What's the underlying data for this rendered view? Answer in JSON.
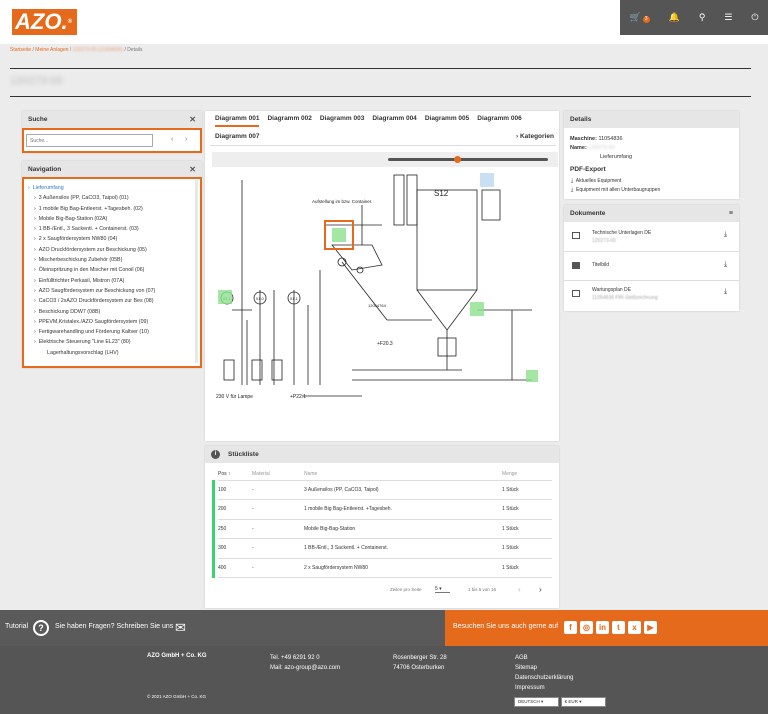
{
  "header": {
    "logo": "AZO.",
    "cart_count": "3"
  },
  "breadcrumb": {
    "home": "Startseite",
    "machines": "Meine Anlagen",
    "machine": "120273-00 (11054836)",
    "details": "Details"
  },
  "page_title": "120273-00",
  "search": {
    "title": "Suche",
    "placeholder": "Suche..."
  },
  "navigation": {
    "title": "Navigation",
    "root": "Lieferumfang",
    "items": [
      "3 Außensilos (PP, CaCO3, Taipol) (01)",
      "1 mobile Big Bag-Entleerst. +Tagesbeh. (02)",
      "Mobile Big-Bag-Station (02A)",
      "1 BB-/Entl., 3 Sackentl. + Containerst. (03)",
      "2 x Saugfördersystem NW80 (04)",
      "AZO Druckfördersystem zur Beschickung (05)",
      "Mischerbeschickung Zubehör (05B)",
      "Öleinspritzung in den Mischer mit Conoil (06)",
      "Einfülltrichter Perkasil, Mistron (07A)",
      "AZO Saugfördersystem zur Beschickung von (07)",
      "CaCO3 / 2xAZO Druckfördersystem zur Bes (08)",
      "Beschickung DDW7 (08B)",
      "PPEVM,Kristalex./AZO Saugfördersystem (09)",
      "Fertigwarehandling und Förderung Kaltver (10)",
      "Elektrische Steuerung \"Line EL23\" (80)",
      "Lagerhaltungsvorschlag (LHV)"
    ]
  },
  "tabs": [
    "Diagramm 001",
    "Diagramm 002",
    "Diagramm 003",
    "Diagramm 004",
    "Diagramm 005",
    "Diagramm 006",
    "Diagramm 007"
  ],
  "kategorien": "Kategorien",
  "diagram": {
    "s12": "S12",
    "label_aufstellung": "Aufstellung im bzw. Container.",
    "v230": "230 V für Lampe",
    "p22": "+P22.1",
    "f20": "+F20.3",
    "l_1205": "12054764",
    "p1": "01.0",
    "p2": "01.1",
    "p3": "01.1"
  },
  "details": {
    "title": "Details",
    "machine_label": "Maschine:",
    "machine": "11054836",
    "name_label": "Name:",
    "name": "120273-00",
    "scope": "Lieferumfang",
    "pdf_title": "PDF-Export",
    "pdf1": "Aktuelles Equipment",
    "pdf2": "Equipment mit allen Unterbaugruppen"
  },
  "documents": {
    "title": "Dokumente",
    "items": [
      {
        "title": "Technische Unterlagen DE",
        "sub": "120273-00"
      },
      {
        "title": "Titelbild",
        "sub": ""
      },
      {
        "title": "Wartungsplan DE",
        "sub": "11054836 PIR-Stellzeichnung"
      }
    ]
  },
  "parts": {
    "title": "Stückliste",
    "cols": [
      "Pos",
      "Material",
      "Name",
      "Menge"
    ],
    "rows": [
      [
        "100",
        "-",
        "3 Außensilos (PP, CaCO3, Taipol)",
        "1 Stück"
      ],
      [
        "200",
        "-",
        "1 mobile Big Bag-Entleerst. +Tagesbeh.",
        "1 Stück"
      ],
      [
        "250",
        "-",
        "Mobile Big-Bag-Station",
        "1 Stück"
      ],
      [
        "300",
        "-",
        "1 BB-/Entl., 3 Sackentl. + Containerst.",
        "1 Stück"
      ],
      [
        "400",
        "-",
        "2 x Saugfördersystem NW80",
        "1 Stück"
      ]
    ],
    "per_page_label": "Zeilen pro Seite",
    "per_page": "5",
    "range": "1 bis 5 von 16"
  },
  "footer": {
    "tutorial": "Tutorial",
    "help": "Sie haben Fragen? Schreiben Sie uns",
    "social": "Besuchen Sie uns auch gerne auf",
    "company": "AZO GmbH + Co. KG",
    "phone": "Tel. +49 6291 92 0",
    "mail": "Mail: azo-group@azo.com",
    "street": "Rosenberger Str. 28",
    "city": "74706 Osterburken",
    "links": [
      "AGB",
      "Sitemap",
      "Datenschutzerklärung",
      "Impressum"
    ],
    "copyright": "© 2021 AZO GmbH + Co. KG",
    "lang": "DEUTSCH",
    "currency": "€ EUR"
  }
}
